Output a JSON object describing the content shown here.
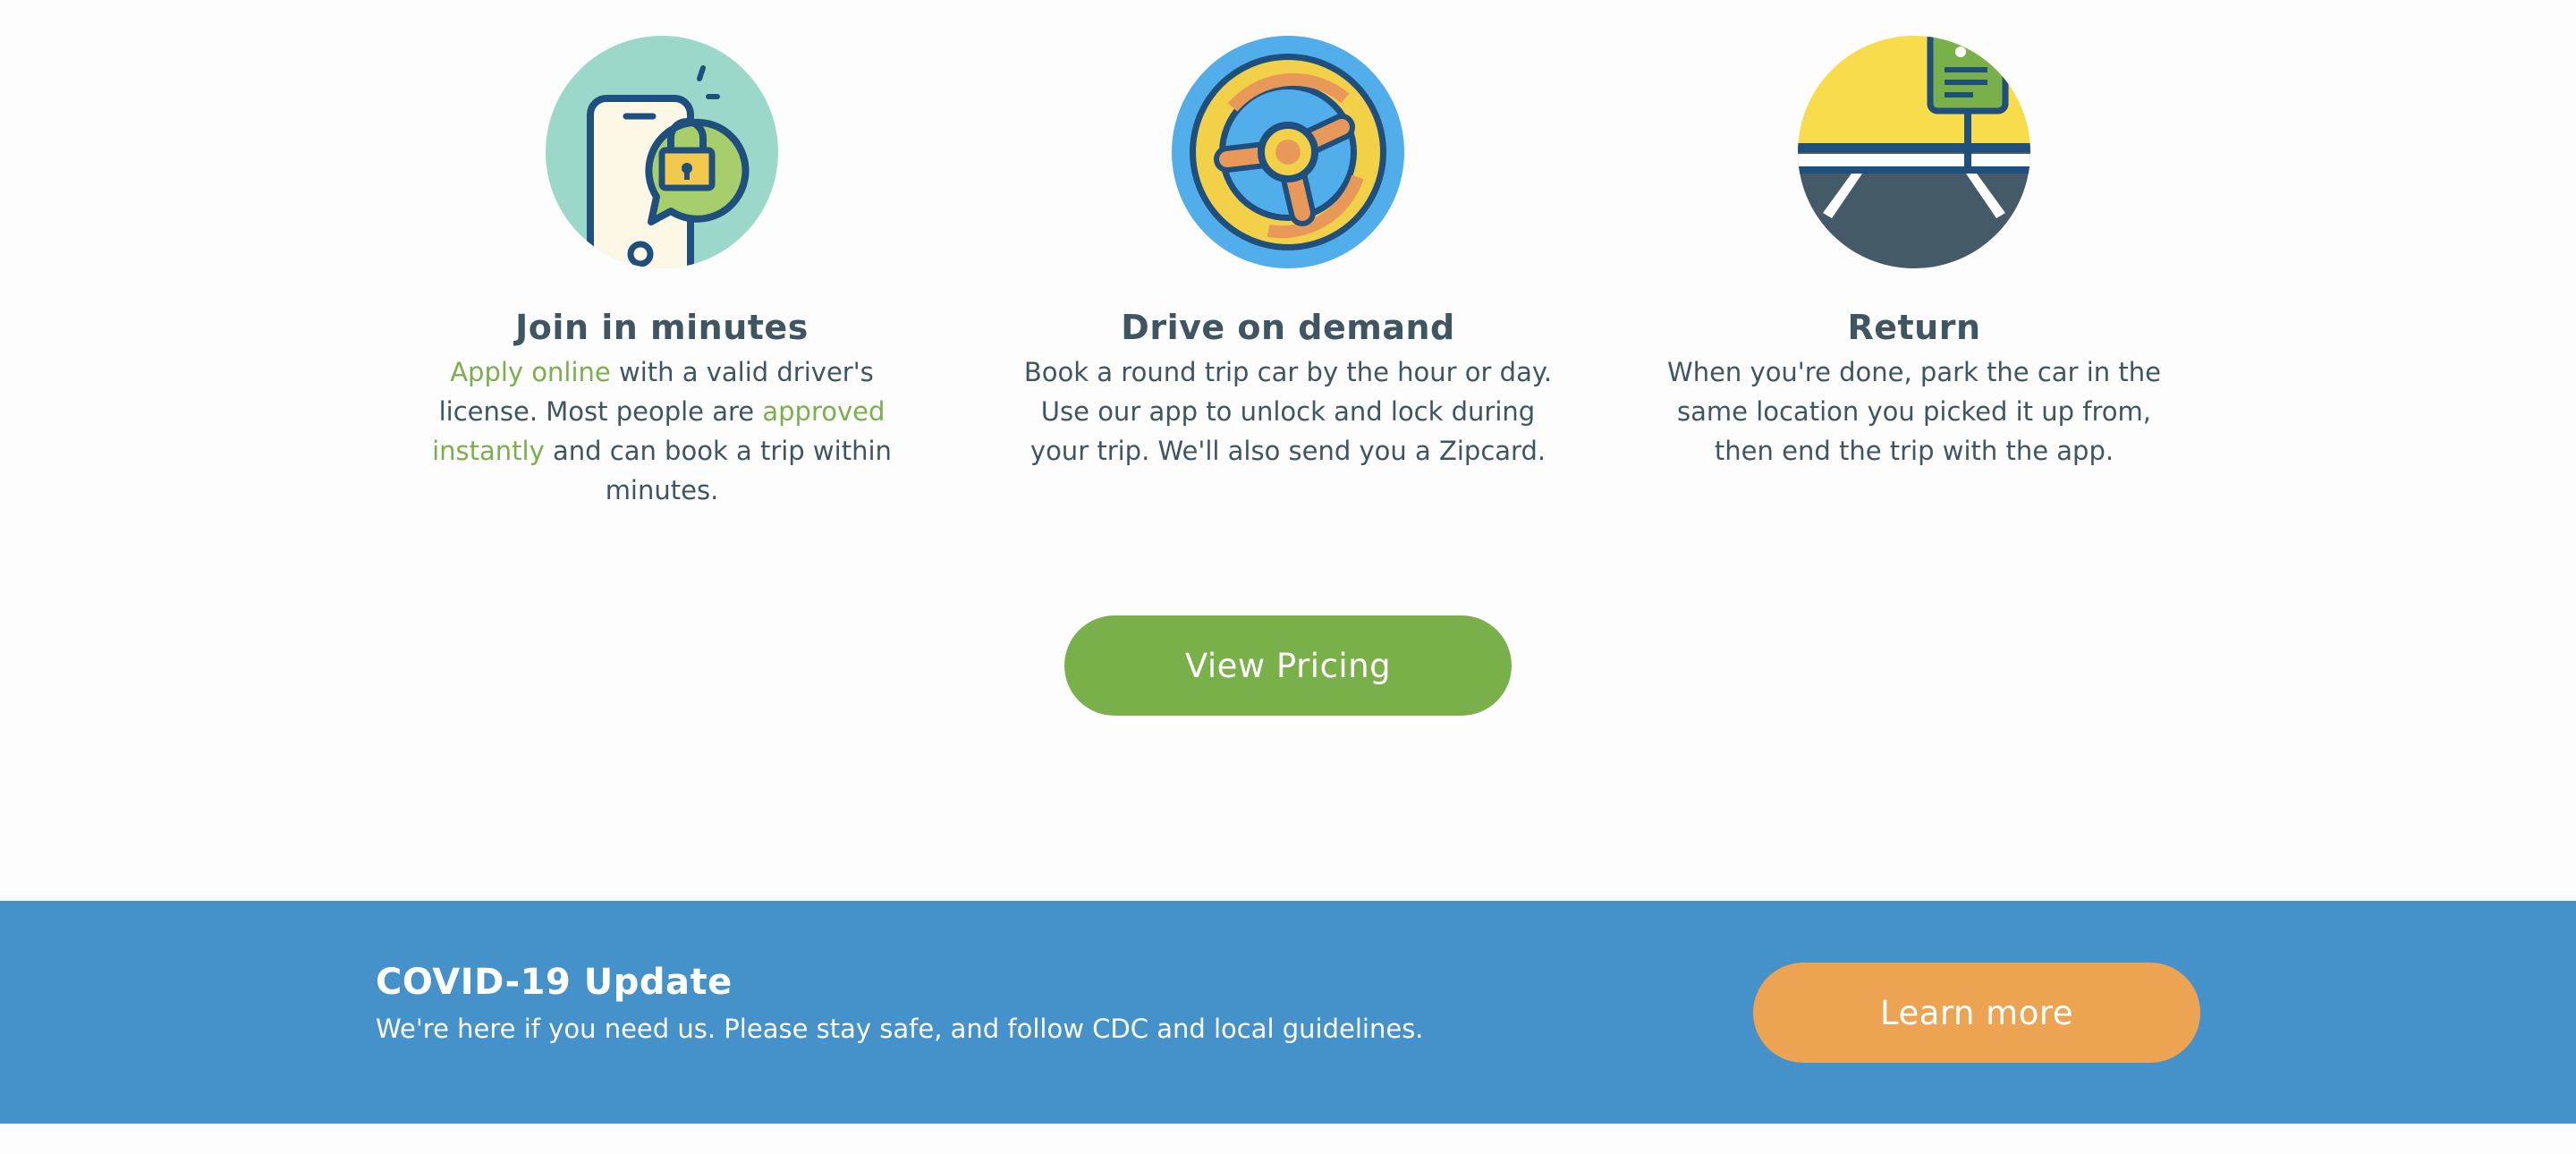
{
  "steps": {
    "join": {
      "title": "Join in minutes",
      "link_apply": "Apply online",
      "text_1": " with a valid driver's license. Most people are ",
      "link_approved": "approved instantly",
      "text_2": " and can book a trip within minutes.",
      "icon": "phone-unlock-icon"
    },
    "drive": {
      "title": "Drive on demand",
      "text": "Book a round trip car by the hour or day. Use our app to unlock and lock during your trip. We'll also send you a Zipcard.",
      "icon": "steering-wheel-icon"
    },
    "return": {
      "title": "Return",
      "text": "When you're done, park the car in the same location you picked it up from, then end the trip with the app.",
      "icon": "parking-sign-icon"
    }
  },
  "pricing_button": {
    "label": "View Pricing"
  },
  "covid": {
    "title": "COVID-19 Update",
    "text": "We're here if you need us. Please stay safe, and follow CDC and local guidelines.",
    "button_label": "Learn more"
  },
  "colors": {
    "accent_green": "#7ab04a",
    "banner_blue": "#4492c9",
    "button_orange": "#eca452",
    "text_dark": "#3f5562"
  }
}
